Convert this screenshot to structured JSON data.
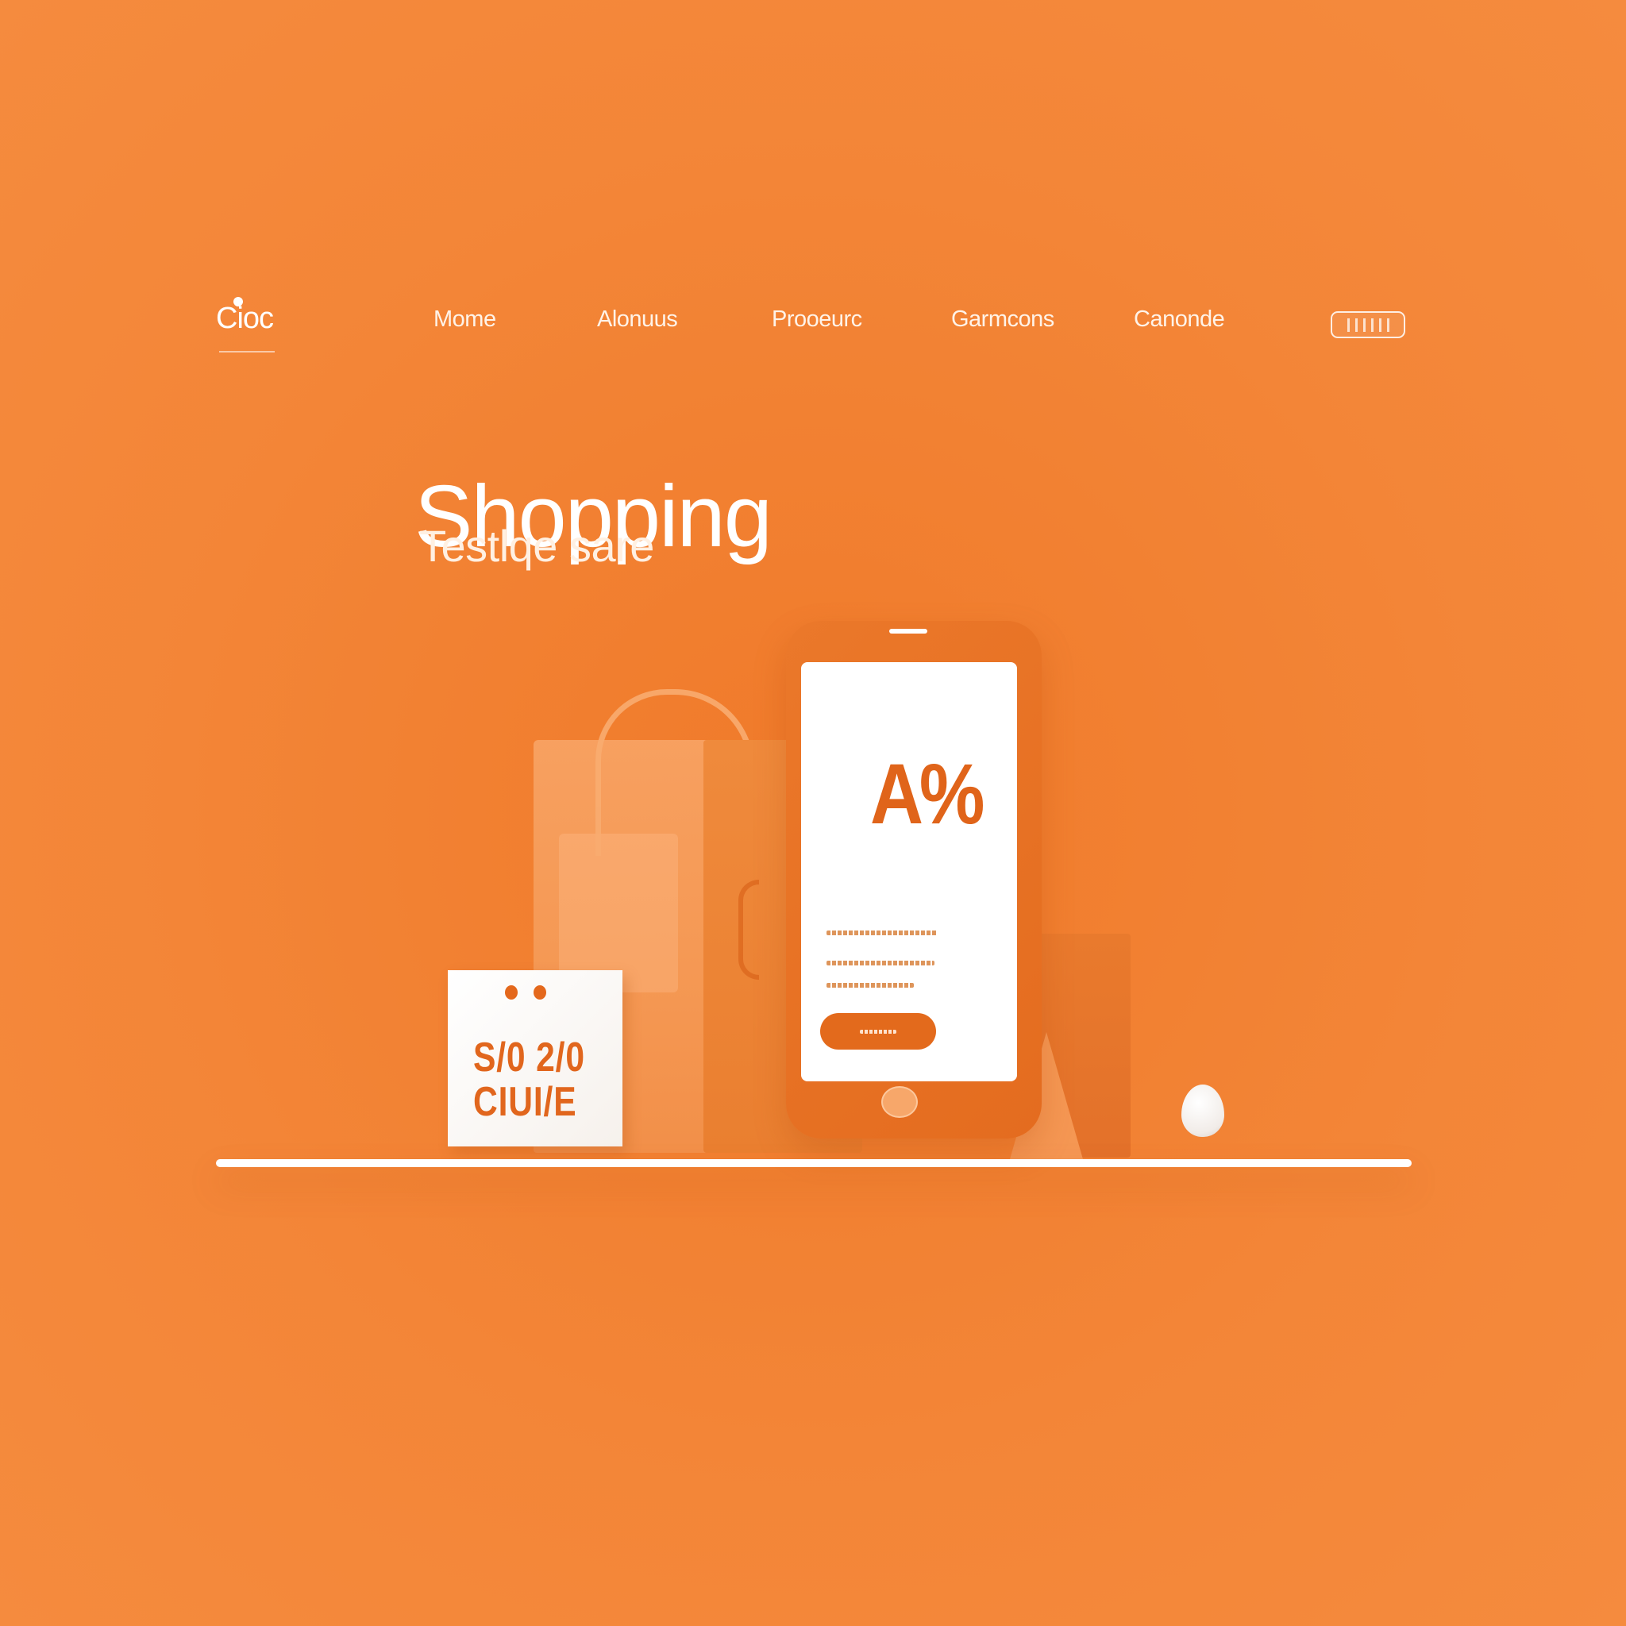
{
  "nav": {
    "logo": "Cioc",
    "links": [
      "Mome",
      "Alonuus",
      "Prooeurc",
      "Garmcons",
      "Canonde"
    ]
  },
  "hero": {
    "title": "Shopping",
    "subtitle": "Testlqe sare"
  },
  "phone": {
    "headline": "A%"
  },
  "tag": {
    "line1": "S/0 2/0",
    "line2": "CIUI/E"
  },
  "colors": {
    "background": "#f38537",
    "accent": "#e36a1c",
    "text": "#ffffff"
  }
}
